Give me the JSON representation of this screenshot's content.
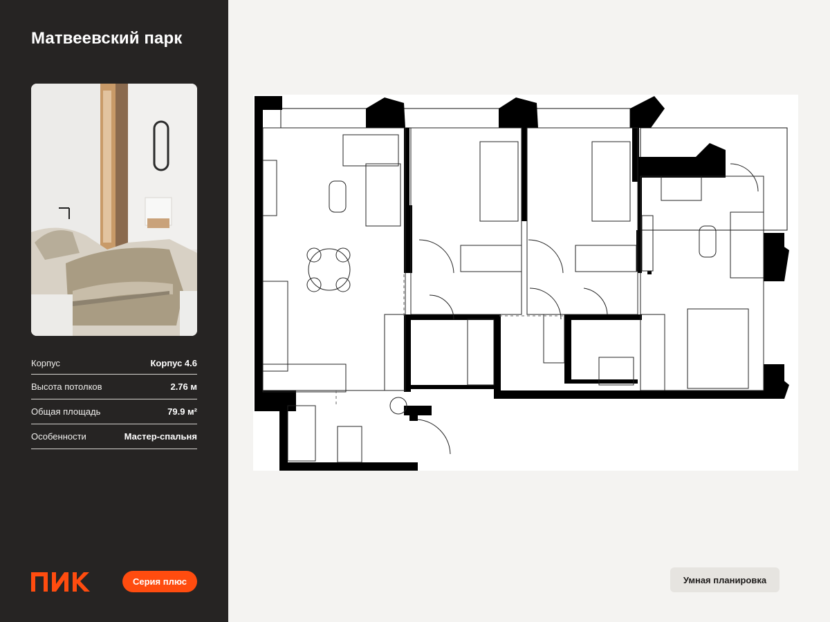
{
  "project": {
    "title": "Матвеевский парк"
  },
  "specs": [
    {
      "label": "Корпус",
      "value": "Корпус 4.6"
    },
    {
      "label": "Высота потолков",
      "value": "2.76 м"
    },
    {
      "label": "Общая площадь",
      "value": "79.9 м²"
    },
    {
      "label": "Особенности",
      "value": "Мастер-спальня"
    }
  ],
  "brand": {
    "logo_text": "ПИК",
    "series_label": "Серия плюс",
    "accent": "#ff4c0f"
  },
  "plan": {
    "smart_button_label": "Умная планировка"
  }
}
